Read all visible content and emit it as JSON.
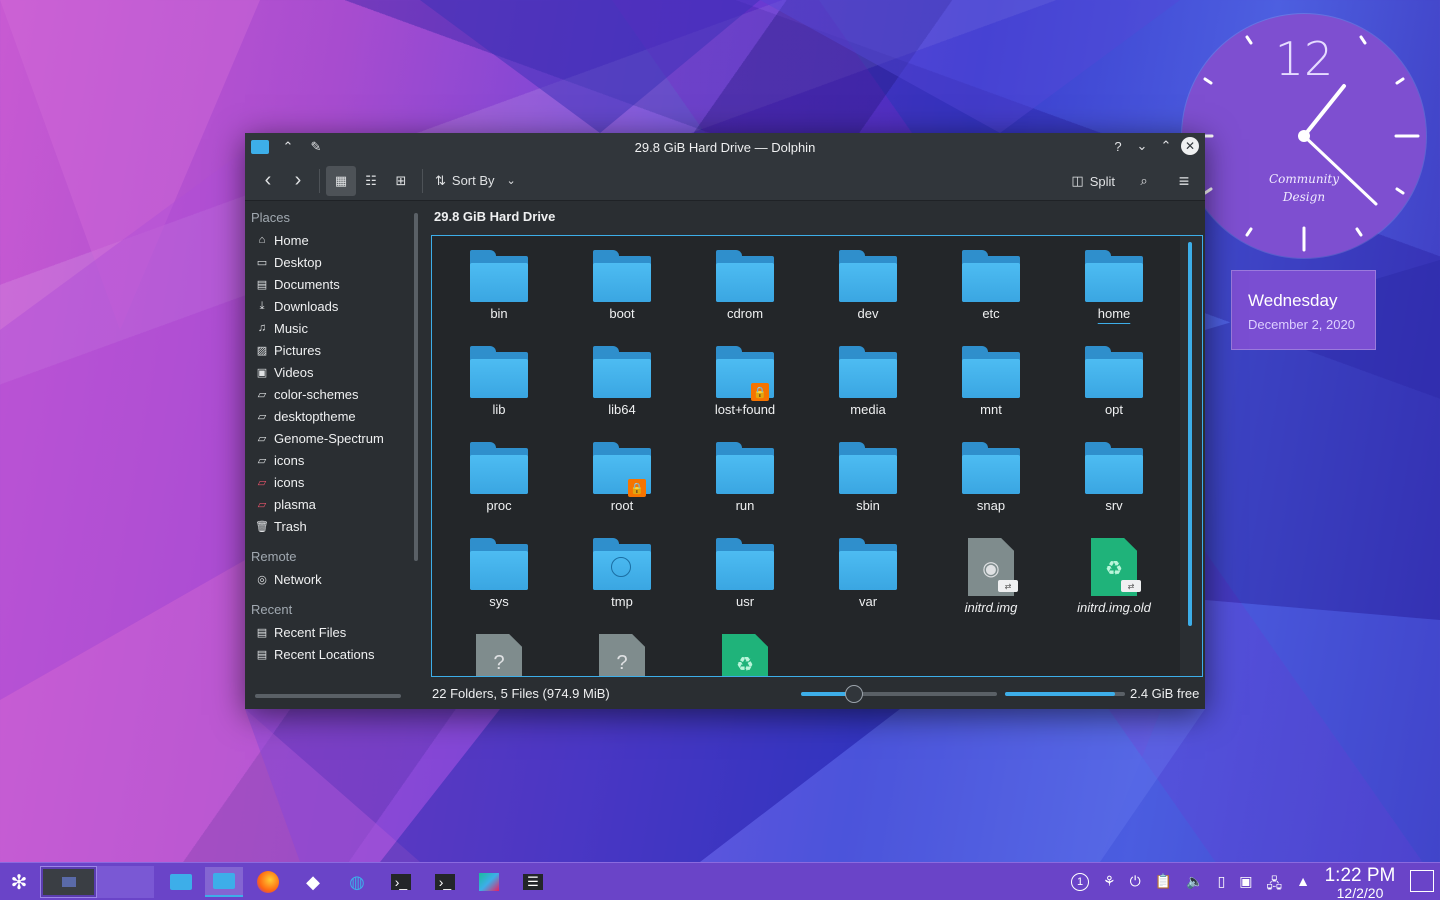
{
  "window": {
    "title": "29.8 GiB Hard Drive — Dolphin",
    "help_symbol": "?",
    "breadcrumb": "29.8 GiB Hard Drive"
  },
  "toolbar": {
    "sort_label": "Sort By",
    "split_label": "Split"
  },
  "sidebar": {
    "places_header": "Places",
    "places": [
      {
        "label": "Home",
        "icon": "home-icon"
      },
      {
        "label": "Desktop",
        "icon": "desktop-icon"
      },
      {
        "label": "Documents",
        "icon": "documents-icon"
      },
      {
        "label": "Downloads",
        "icon": "downloads-icon"
      },
      {
        "label": "Music",
        "icon": "music-icon"
      },
      {
        "label": "Pictures",
        "icon": "pictures-icon"
      },
      {
        "label": "Videos",
        "icon": "videos-icon"
      },
      {
        "label": "color-schemes",
        "icon": "folder-icon"
      },
      {
        "label": "desktoptheme",
        "icon": "folder-icon"
      },
      {
        "label": "Genome-Spectrum",
        "icon": "folder-icon"
      },
      {
        "label": "icons",
        "icon": "folder-icon"
      },
      {
        "label": "icons",
        "icon": "folder-red-icon"
      },
      {
        "label": "plasma",
        "icon": "folder-red-icon"
      },
      {
        "label": "Trash",
        "icon": "trash-icon"
      }
    ],
    "remote_header": "Remote",
    "remote": [
      {
        "label": "Network",
        "icon": "network-icon"
      }
    ],
    "recent_header": "Recent",
    "recent": [
      {
        "label": "Recent Files",
        "icon": "recent-files-icon"
      },
      {
        "label": "Recent Locations",
        "icon": "recent-locations-icon"
      }
    ]
  },
  "files": [
    {
      "name": "bin",
      "type": "folder"
    },
    {
      "name": "boot",
      "type": "folder"
    },
    {
      "name": "cdrom",
      "type": "folder"
    },
    {
      "name": "dev",
      "type": "folder"
    },
    {
      "name": "etc",
      "type": "folder"
    },
    {
      "name": "home",
      "type": "folder"
    },
    {
      "name": "lib",
      "type": "folder"
    },
    {
      "name": "lib64",
      "type": "folder"
    },
    {
      "name": "lost+found",
      "type": "folder-locked"
    },
    {
      "name": "media",
      "type": "folder"
    },
    {
      "name": "mnt",
      "type": "folder"
    },
    {
      "name": "opt",
      "type": "folder"
    },
    {
      "name": "proc",
      "type": "folder"
    },
    {
      "name": "root",
      "type": "folder-locked"
    },
    {
      "name": "run",
      "type": "folder"
    },
    {
      "name": "sbin",
      "type": "folder"
    },
    {
      "name": "snap",
      "type": "folder"
    },
    {
      "name": "srv",
      "type": "folder"
    },
    {
      "name": "sys",
      "type": "folder"
    },
    {
      "name": "tmp",
      "type": "folder-temp"
    },
    {
      "name": "usr",
      "type": "folder"
    },
    {
      "name": "var",
      "type": "folder"
    },
    {
      "name": "initrd.img",
      "type": "disk-image-link"
    },
    {
      "name": "initrd.img.old",
      "type": "archive-link"
    },
    {
      "name": "",
      "type": "unknown-locked"
    },
    {
      "name": "",
      "type": "unknown-locked"
    },
    {
      "name": "",
      "type": "archive-link"
    }
  ],
  "statusbar": {
    "summary": "22 Folders, 5 Files (974.9 MiB)",
    "free_space": "2.4 GiB free",
    "free_fraction": 0.92
  },
  "widgets": {
    "clock_number": "12",
    "clock_text_1": "Community",
    "clock_text_2": "Design",
    "day": "Wednesday",
    "date": "December 2, 2020"
  },
  "taskbar": {
    "time": "1:22 PM",
    "date": "12/2/20",
    "badge_count": "1"
  },
  "colors": {
    "accent": "#3daee9",
    "window_bg": "#2a2e32",
    "taskbar": "#6a44c8",
    "lock_badge": "#f67400"
  }
}
